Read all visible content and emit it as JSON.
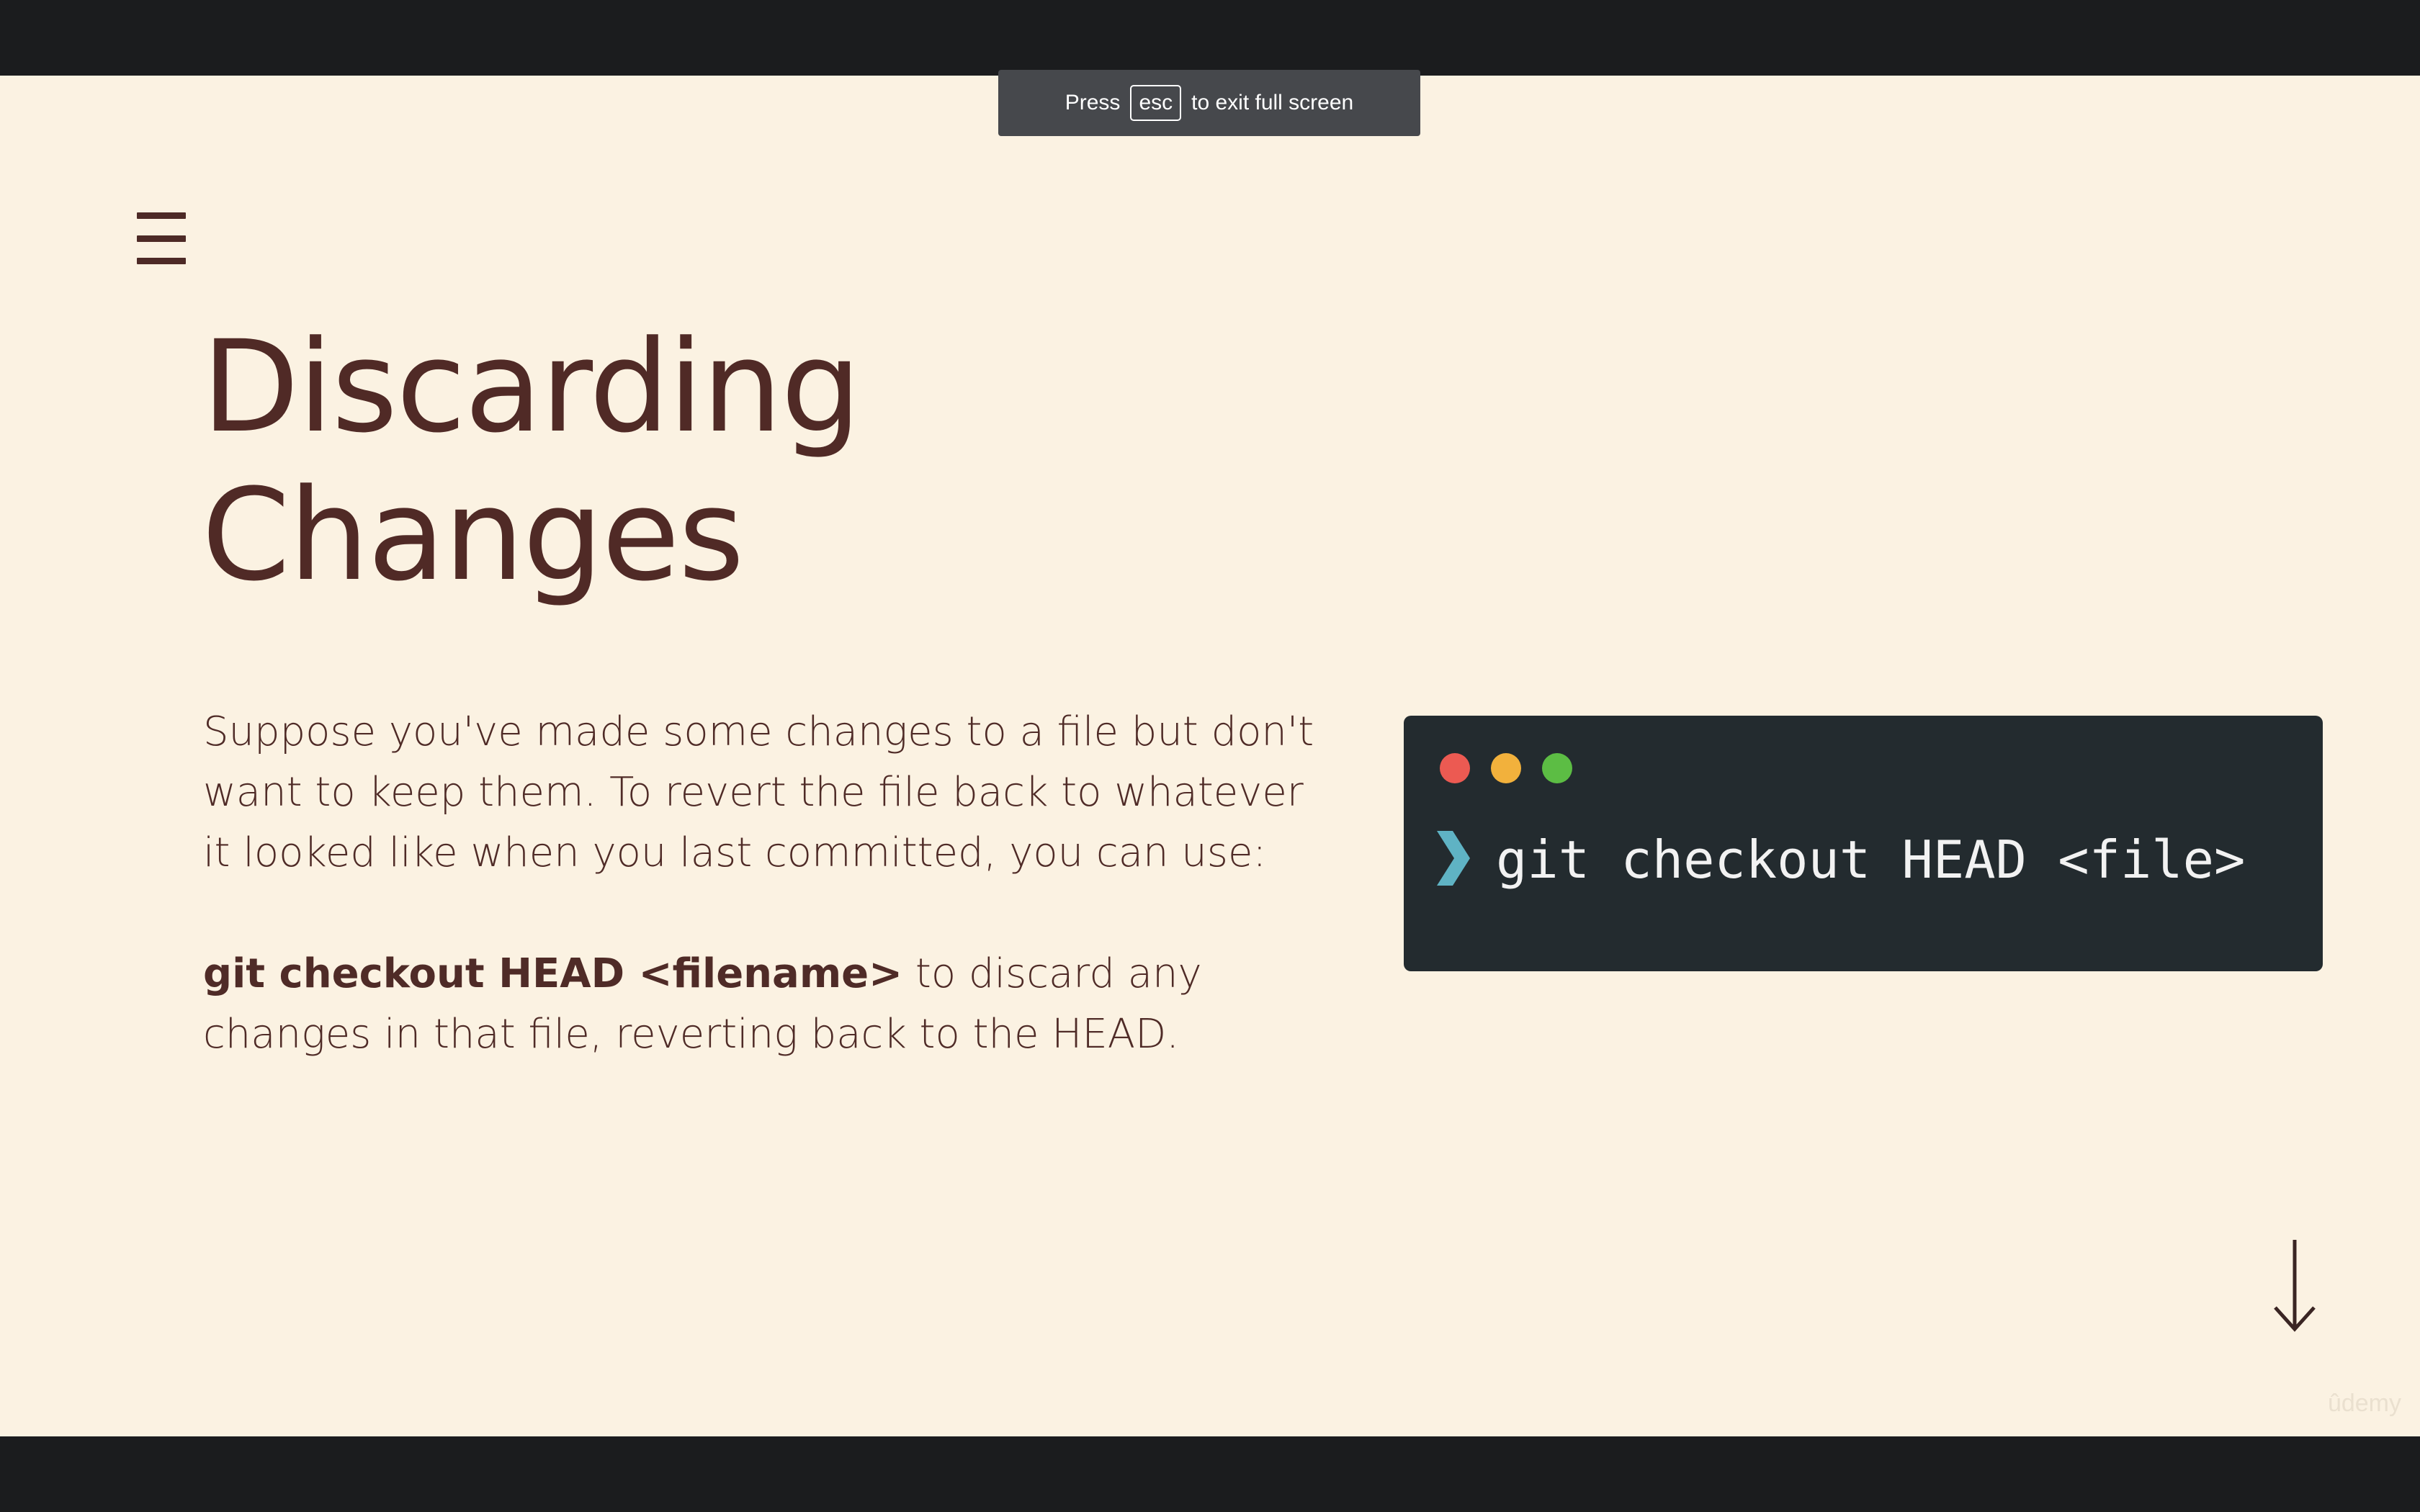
{
  "fullscreen_notice": {
    "before": "Press",
    "key": "esc",
    "after": "to exit full screen"
  },
  "slide": {
    "title_line1": "Discarding",
    "title_line2": "Changes",
    "paragraph1": "Suppose you've made some changes to a file but don't want to keep them.  To revert the file back to whatever it looked like when you last committed, you can use:",
    "paragraph2_bold": "git checkout HEAD <filename>",
    "paragraph2_rest": " to discard any changes in that file, reverting back to the HEAD."
  },
  "terminal": {
    "prompt_icon": "chevron-right-icon",
    "command": "git checkout HEAD <file>",
    "window_dots": [
      "#ec5a52",
      "#f2b13c",
      "#5cbd44"
    ],
    "prompt_color": "#5fb3c4"
  },
  "icons": {
    "menu": "menu-icon",
    "next": "arrow-down-icon"
  },
  "watermark": "ûdemy",
  "colors": {
    "slide_background": "#fbf2e2",
    "text": "#4f2b27",
    "terminal_background": "#232b2f",
    "letterbox": "#1b1c1e"
  }
}
